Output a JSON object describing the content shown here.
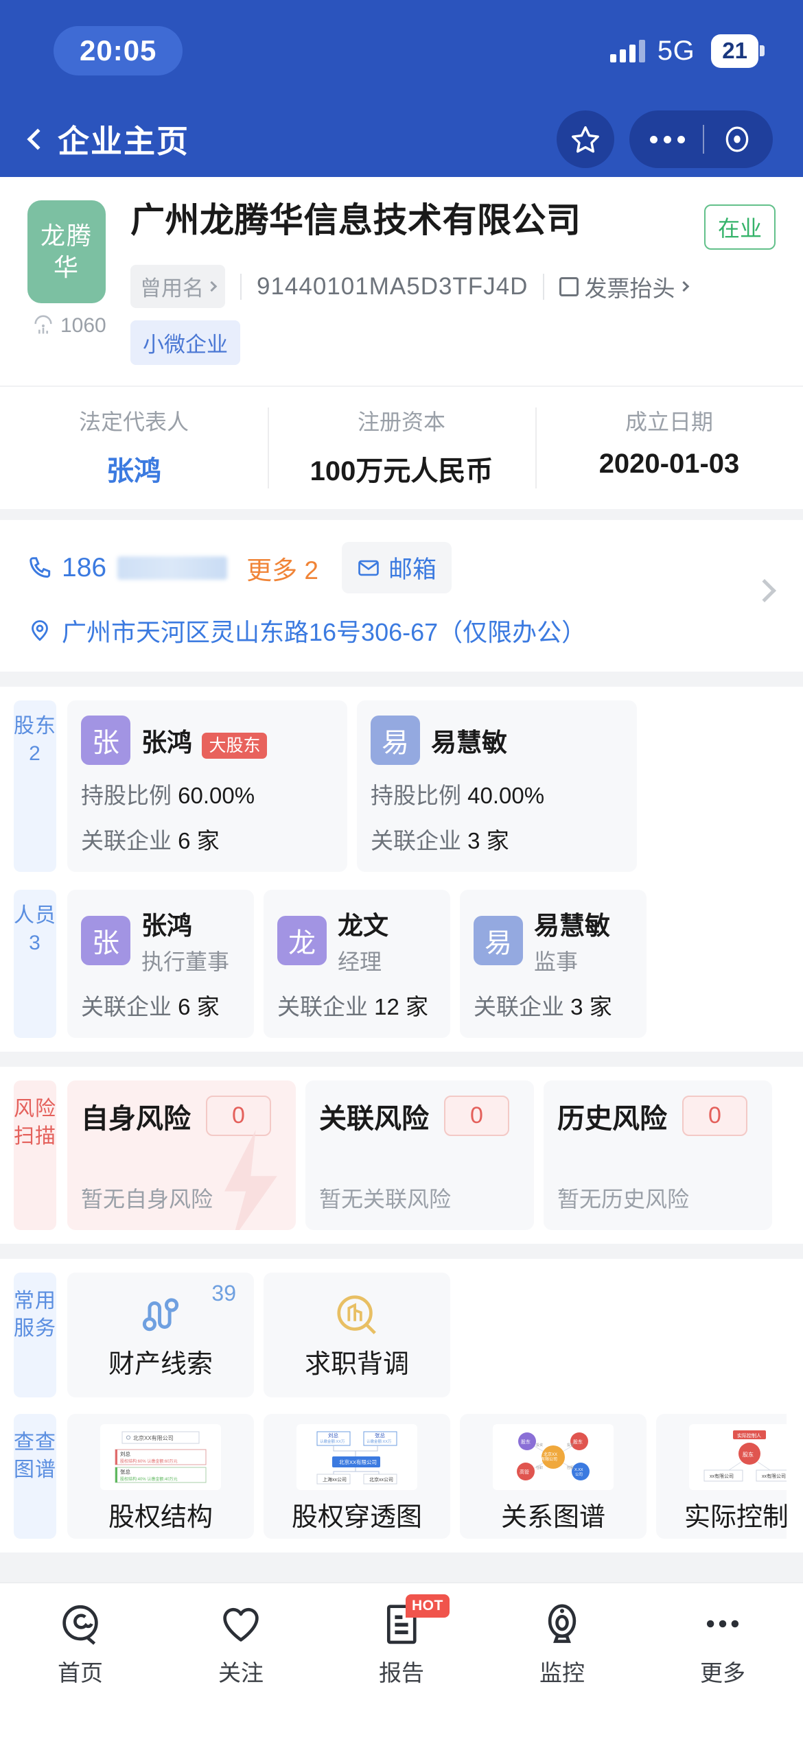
{
  "status_bar": {
    "time": "20:05",
    "network": "5G",
    "battery": "21",
    "signal_icon": "signal-bars-icon",
    "battery_icon": "battery-icon"
  },
  "nav": {
    "back_icon": "chevron-left-icon",
    "title": "企业主页",
    "favorite_icon": "star-icon",
    "more_icon": "ellipsis-icon",
    "target_icon": "target-circle-icon"
  },
  "company": {
    "logo_text": "龙腾华",
    "logo_color": "#7cc0a2",
    "score": "1060",
    "score_icon": "radar-score-icon",
    "name": "广州龙腾华信息技术有限公司",
    "status_badge": "在业",
    "status_color": "#35b36a",
    "former_name_label": "曾用名",
    "credit_code": "91440101MA5D3TFJ4D",
    "invoice_label": "发票抬头",
    "invoice_icon": "invoice-icon",
    "tag": "小微企业",
    "stats": [
      {
        "label": "法定代表人",
        "value": "张鸿",
        "is_link": true
      },
      {
        "label": "注册资本",
        "value": "100万元人民币",
        "is_link": false
      },
      {
        "label": "成立日期",
        "value": "2020-01-03",
        "is_link": false
      }
    ]
  },
  "contact": {
    "phone_icon": "phone-icon",
    "phone_prefix": "186",
    "more_label": "更多",
    "more_count": "2",
    "email_icon": "mail-icon",
    "email_label": "邮箱",
    "address_icon": "location-pin-icon",
    "address": "广州市天河区灵山东路16号306-67（仅限办公）",
    "chevron_icon": "chevron-right-icon"
  },
  "shareholders": {
    "side_label": "股东",
    "side_count": "2",
    "items": [
      {
        "initial": "张",
        "avatar_color": "#a294e3",
        "name": "张鸿",
        "badge": "大股东",
        "badge_color": "#e8625c",
        "ratio_label": "持股比例",
        "ratio_value": "60.00%",
        "related_label": "关联企业",
        "related_value": "6 家"
      },
      {
        "initial": "易",
        "avatar_color": "#94a9e0",
        "name": "易慧敏",
        "badge": "",
        "badge_color": "",
        "ratio_label": "持股比例",
        "ratio_value": "40.00%",
        "related_label": "关联企业",
        "related_value": "3 家"
      }
    ]
  },
  "members": {
    "side_label": "人员",
    "side_count": "3",
    "items": [
      {
        "initial": "张",
        "avatar_color": "#a294e3",
        "name": "张鸿",
        "role": "执行董事",
        "related_label": "关联企业",
        "related_value": "6 家"
      },
      {
        "initial": "龙",
        "avatar_color": "#a294e3",
        "name": "龙文",
        "role": "经理",
        "related_label": "关联企业",
        "related_value": "12 家"
      },
      {
        "initial": "易",
        "avatar_color": "#94a9e0",
        "name": "易慧敏",
        "role": "监事",
        "related_label": "关联企业",
        "related_value": "3 家"
      }
    ]
  },
  "risk": {
    "side_label": "风险扫描",
    "items": [
      {
        "title": "自身风险",
        "count": "0",
        "empty_text": "暂无自身风险",
        "highlighted": true
      },
      {
        "title": "关联风险",
        "count": "0",
        "empty_text": "暂无关联风险",
        "highlighted": false
      },
      {
        "title": "历史风险",
        "count": "0",
        "empty_text": "暂无历史风险",
        "highlighted": false
      }
    ]
  },
  "services": {
    "side_label": "常用服务",
    "items": [
      {
        "label": "财产线索",
        "badge": "39",
        "icon": "property-clue-icon"
      },
      {
        "label": "求职背调",
        "badge": "",
        "icon": "background-check-icon"
      }
    ]
  },
  "graphs": {
    "side_label": "查查图谱",
    "items": [
      {
        "label": "股权结构",
        "thumb": "equity-structure-thumb"
      },
      {
        "label": "股权穿透图",
        "thumb": "equity-penetration-thumb"
      },
      {
        "label": "关系图谱",
        "thumb": "relation-graph-thumb"
      },
      {
        "label": "实际控制人",
        "thumb": "actual-controller-thumb"
      }
    ]
  },
  "tabbar": {
    "items": [
      {
        "label": "首页",
        "icon": "home-at-icon",
        "badge": ""
      },
      {
        "label": "关注",
        "icon": "heart-icon",
        "badge": ""
      },
      {
        "label": "报告",
        "icon": "report-doc-icon",
        "badge": "HOT"
      },
      {
        "label": "监控",
        "icon": "monitor-icon",
        "badge": ""
      },
      {
        "label": "更多",
        "icon": "ellipsis-icon",
        "badge": ""
      }
    ]
  }
}
